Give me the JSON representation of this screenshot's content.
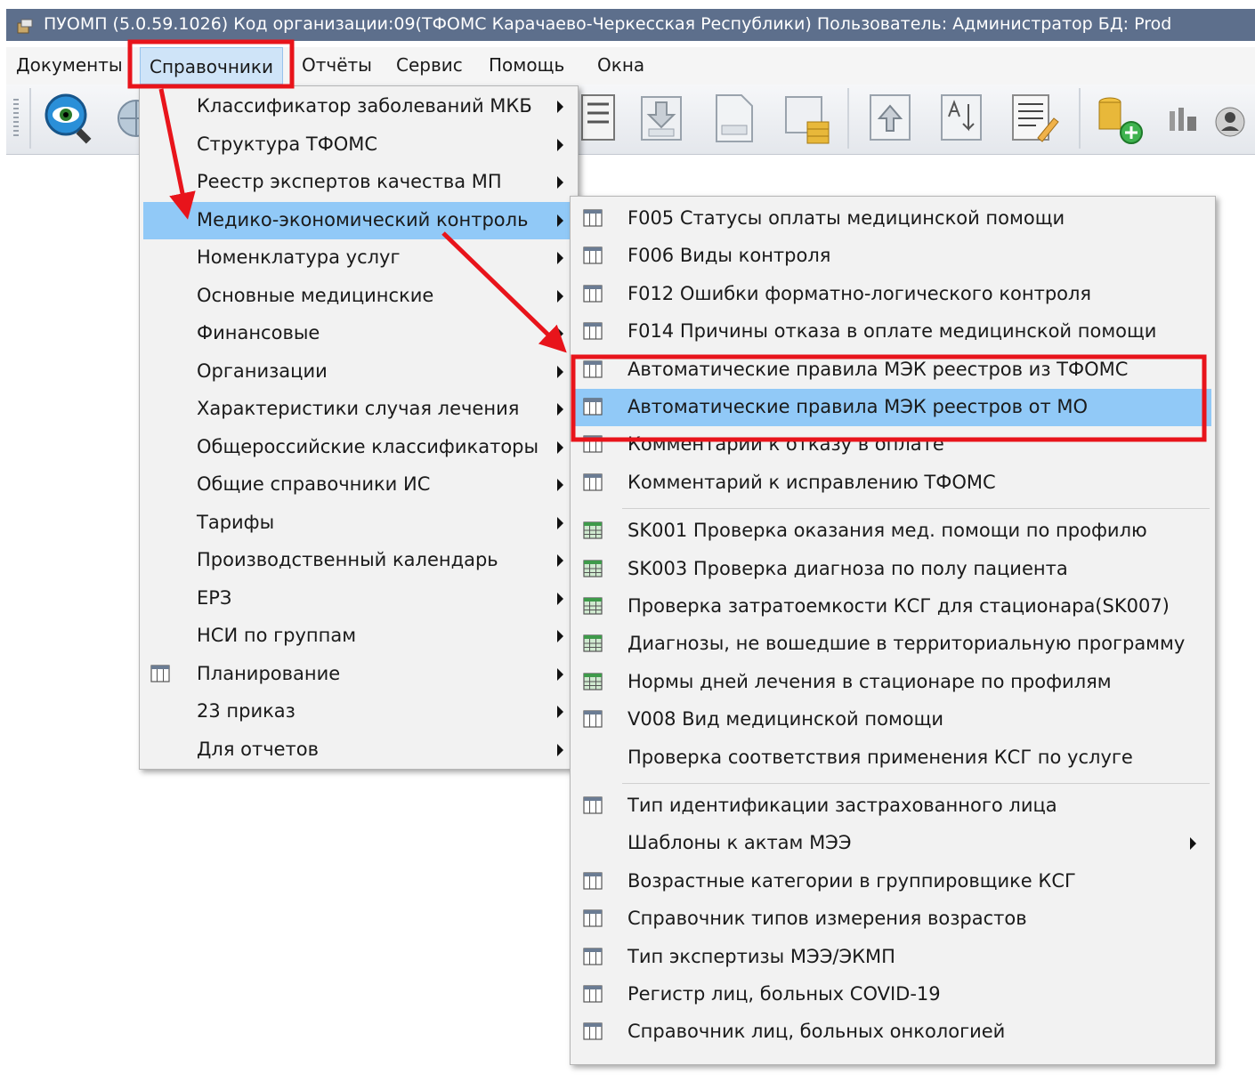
{
  "window": {
    "title": "ПУОМП (5.0.59.1026)  Код организации:09(ТФОМС Карачаево-Черкесская Республики)  Пользователь: Администратор БД: Prod"
  },
  "menubar": {
    "items": [
      "Документы",
      "Справочники",
      "Отчёты",
      "Сервис",
      "Помощь",
      "Окна"
    ],
    "active": "Справочники"
  },
  "toolbar": {
    "buttons": [
      "view-icon",
      "globe-icon",
      "import-xml-icon",
      "download-mo-icon",
      "document-mo-icon",
      "mo-coins-icon",
      "upload-icon",
      "sort-icon",
      "report-edit-icon",
      "coins-add-icon",
      "bank-icon",
      "user-icon"
    ]
  },
  "menu_reference": {
    "items": [
      {
        "label": "Классификатор заболеваний МКБ",
        "submenu": true,
        "icon": null
      },
      {
        "label": "Структура ТФОМС",
        "submenu": true,
        "icon": null
      },
      {
        "label": "Реестр экспертов качества МП",
        "submenu": true,
        "icon": null
      },
      {
        "label": "Медико-экономический контроль",
        "submenu": true,
        "icon": null,
        "highlighted": true
      },
      {
        "label": "Номенклатура услуг",
        "submenu": true,
        "icon": null
      },
      {
        "label": "Основные медицинские",
        "submenu": true,
        "icon": null
      },
      {
        "label": "Финансовые",
        "submenu": true,
        "icon": null
      },
      {
        "label": "Организации",
        "submenu": true,
        "icon": null
      },
      {
        "label": "Характеристики случая лечения",
        "submenu": true,
        "icon": null
      },
      {
        "label": "Общероссийские классификаторы",
        "submenu": true,
        "icon": null
      },
      {
        "label": "Общие справочники ИС",
        "submenu": true,
        "icon": null
      },
      {
        "label": "Тарифы",
        "submenu": true,
        "icon": null
      },
      {
        "label": "Производственный календарь",
        "submenu": true,
        "icon": null
      },
      {
        "label": "ЕРЗ",
        "submenu": true,
        "icon": null
      },
      {
        "label": "НСИ по группам",
        "submenu": true,
        "icon": null
      },
      {
        "label": "Планирование",
        "submenu": true,
        "icon": "table-icon"
      },
      {
        "label": "23 приказ",
        "submenu": true,
        "icon": null
      },
      {
        "label": "Для отчетов",
        "submenu": true,
        "icon": null
      }
    ]
  },
  "menu_mek": {
    "items": [
      {
        "label": "F005 Статусы оплаты медицинской помощи",
        "icon": "table-icon"
      },
      {
        "label": "F006 Виды контроля",
        "icon": "table-icon"
      },
      {
        "label": "F012 Ошибки форматно-логического контроля",
        "icon": "table-icon"
      },
      {
        "label": "F014 Причины отказа в оплате медицинской помощи",
        "icon": "table-icon"
      },
      {
        "label": "Автоматические правила МЭК реестров из ТФОМС",
        "icon": "table-icon"
      },
      {
        "label": "Автоматические правила МЭК реестров от МО",
        "icon": "table-icon",
        "highlighted": true
      },
      {
        "label": "Комментарии к отказу в оплате",
        "icon": "table-icon"
      },
      {
        "label": "Комментарий к исправлению ТФОМС",
        "icon": "table-icon"
      },
      {
        "separator": true
      },
      {
        "label": "SK001 Проверка оказания мед. помощи по профилю",
        "icon": "green-table-icon"
      },
      {
        "label": "SK003 Проверка диагноза по полу пациента",
        "icon": "green-table-icon"
      },
      {
        "label": "Проверка затратоемкости КСГ для стационара(SK007)",
        "icon": "green-table-icon"
      },
      {
        "label": "Диагнозы, не вошедшие в территориальную программу",
        "icon": "green-table-icon"
      },
      {
        "label": "Нормы дней лечения в стационаре по профилям",
        "icon": "green-table-icon"
      },
      {
        "label": "V008 Вид медицинской помощи",
        "icon": "table-icon"
      },
      {
        "label": "Проверка соответствия применения КСГ по услуге",
        "icon": null
      },
      {
        "separator": true
      },
      {
        "label": "Тип идентификации застрахованного лица",
        "icon": "table-icon"
      },
      {
        "label": "Шаблоны к актам МЭЭ",
        "icon": null,
        "submenu": true
      },
      {
        "label": "Возрастные категории в группировщике КСГ",
        "icon": "table-icon"
      },
      {
        "label": "Справочник типов измерения возрастов",
        "icon": "table-icon"
      },
      {
        "label": "Тип экспертизы МЭЭ/ЭКМП",
        "icon": "table-icon"
      },
      {
        "label": "Регистр лиц, больных COVID-19",
        "icon": "table-icon"
      },
      {
        "label": "Справочник лиц, больных онкологией",
        "icon": "table-icon"
      }
    ]
  },
  "annotations": {
    "color": "#e8141b",
    "highlight_boxes": [
      "menubar-Справочники",
      "mek-rules-group"
    ],
    "arrows": [
      "Справочники → Медико-экономический контроль",
      "Медико-экономический контроль → Автоматические правила"
    ]
  }
}
